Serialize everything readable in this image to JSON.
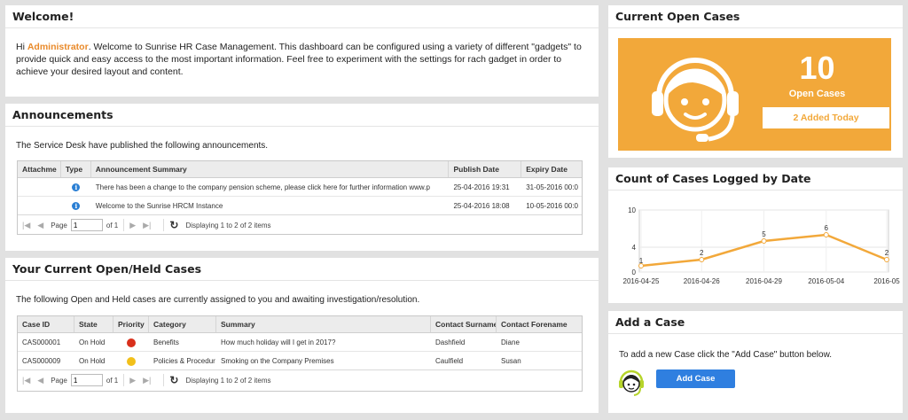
{
  "welcome": {
    "title": "Welcome!",
    "hi": "Hi",
    "user": "Administrator",
    "text": ".  Welcome to Sunrise HR Case Management. This dashboard can be configured using a variety of different \"gadgets\" to provide quick and easy access to the most important information. Feel free to experiment with the settings for rach gadget in order to achieve your desired layout and content."
  },
  "announcements": {
    "title": "Announcements",
    "intro": "The Service Desk have published the following announcements.",
    "columns": [
      "Attachme",
      "Type",
      "Announcement Summary",
      "Publish Date",
      "Expiry Date"
    ],
    "rows": [
      {
        "summary": "There has been a change to the company pension scheme, please click here for further information www.p",
        "publish": "25-04-2016 19:31",
        "expiry": "31-05-2016 00:0",
        "type_icon": "info-icon"
      },
      {
        "summary": "Welcome to the Sunrise HRCM Instance",
        "publish": "25-04-2016 18:08",
        "expiry": "10-05-2016 00:0",
        "type_icon": "info-icon"
      }
    ],
    "pager": {
      "page_label": "Page",
      "page_value": "1",
      "of": "of 1",
      "display": "Displaying 1 to 2 of 2 items"
    }
  },
  "cases": {
    "title": "Your Current Open/Held Cases",
    "intro": "The following Open and Held cases are currently assigned to you and awaiting investigation/resolution.",
    "columns": [
      "Case ID",
      "State",
      "Priority",
      "Category",
      "Summary",
      "Contact Surname",
      "Contact Forename"
    ],
    "rows": [
      {
        "id": "CAS000001",
        "state": "On Hold",
        "priority_color": "#d9301c",
        "category": "Benefits",
        "summary": "How much holiday will I get in 2017?",
        "surname": "Dashfield",
        "forename": "Diane"
      },
      {
        "id": "CAS000009",
        "state": "On Hold",
        "priority_color": "#f2c01a",
        "category": "Policies & Procedur",
        "summary": "Smoking on the Company Premises",
        "surname": "Caulfield",
        "forename": "Susan"
      }
    ],
    "pager": {
      "page_label": "Page",
      "page_value": "1",
      "of": "of 1",
      "display": "Displaying 1 to 2 of 2 items"
    }
  },
  "open_cases": {
    "title": "Current Open Cases",
    "count": "10",
    "label": "Open Cases",
    "added": "2 Added Today",
    "accent": "#f2a83a",
    "icon": "support-agent-icon"
  },
  "chart_section": {
    "title": "Count of Cases Logged by Date"
  },
  "chart_data": {
    "type": "line",
    "title": "Count of Cases Logged by Date",
    "x": [
      "2016-04-25",
      "2016-04-26",
      "2016-04-29",
      "2016-05-04",
      "2016-05"
    ],
    "values": [
      1,
      2,
      5,
      6,
      2
    ],
    "y_ticks": [
      "0",
      "4",
      "10"
    ],
    "ylim": [
      0,
      10
    ],
    "color": "#f2a83a",
    "grid": true
  },
  "add_case": {
    "title": "Add a Case",
    "text": "To add a new Case click the \"Add Case\" button below.",
    "button": "Add Case",
    "button_color": "#2f7fe0",
    "icon": "support-agent-icon"
  }
}
